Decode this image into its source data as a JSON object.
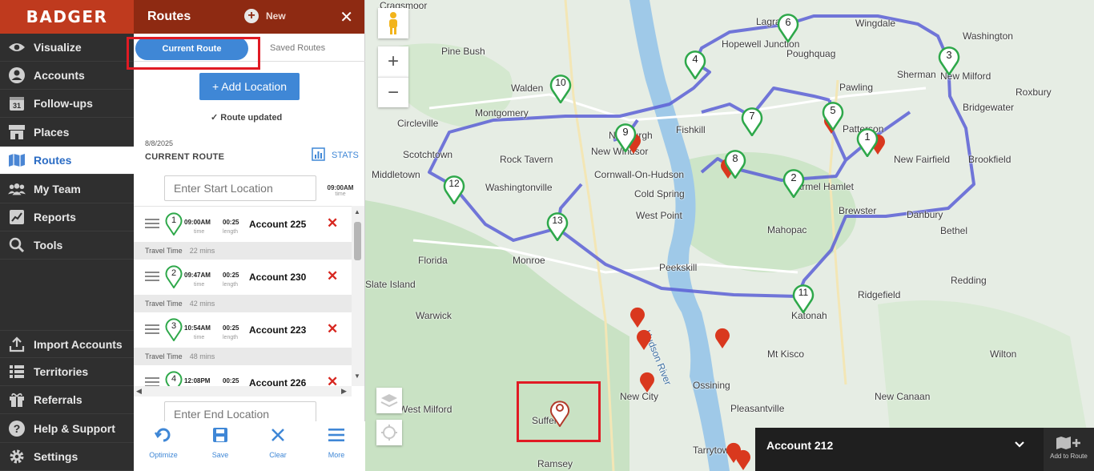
{
  "brand": "BADGER",
  "nav": {
    "items": [
      {
        "label": "Visualize"
      },
      {
        "label": "Accounts"
      },
      {
        "label": "Follow-ups"
      },
      {
        "label": "Places"
      },
      {
        "label": "Routes"
      },
      {
        "label": "My Team"
      },
      {
        "label": "Reports"
      },
      {
        "label": "Tools"
      }
    ],
    "bottom_items": [
      {
        "label": "Import Accounts"
      },
      {
        "label": "Territories"
      },
      {
        "label": "Referrals"
      },
      {
        "label": "Help & Support"
      },
      {
        "label": "Settings"
      }
    ],
    "active": "Routes"
  },
  "panel": {
    "title": "Routes",
    "new_label": "New",
    "close": "✕",
    "tabs": {
      "current": "Current Route",
      "saved": "Saved Routes"
    },
    "add_location": "+ Add Location",
    "route_updated": "Route updated",
    "route_date": "8/8/2025",
    "route_label": "CURRENT ROUTE",
    "stats": "STATS",
    "start_placeholder": "Enter Start Location",
    "start_time": "09:00AM",
    "time_label": "time",
    "length_label": "length",
    "travel_label": "Travel Time",
    "end_placeholder": "Enter End Location",
    "stops": [
      {
        "num": "1",
        "time": "09:00AM",
        "length": "00:25",
        "account": "Account 225",
        "travel": "22 mins"
      },
      {
        "num": "2",
        "time": "09:47AM",
        "length": "00:25",
        "account": "Account 230",
        "travel": "42 mins"
      },
      {
        "num": "3",
        "time": "10:54AM",
        "length": "00:25",
        "account": "Account 223",
        "travel": "48 mins"
      },
      {
        "num": "4",
        "time": "12:08PM",
        "length": "00:25",
        "account": "Account 226"
      }
    ],
    "footer": {
      "optimize": "Optimize",
      "save": "Save",
      "clear": "Clear",
      "more": "More"
    }
  },
  "map": {
    "places": [
      "Cragsmoor",
      "Lagrange",
      "Wingdale",
      "Washington",
      "Pine Bush",
      "Hopewell Junction",
      "Poughquag",
      "Sherman",
      "New Milford",
      "Walden",
      "Pawling",
      "Roxbury",
      "Fishkill",
      "Montgomery",
      "Bridgewater",
      "Circleville",
      "Patterson",
      "Newburgh",
      "New Windsor",
      "Rock Tavern",
      "New Fairfield",
      "Brookfield",
      "Scotchtown",
      "Cornwall-On-Hudson",
      "Middletown",
      "Washingtonville",
      "Cold Spring",
      "Carmel Hamlet",
      "West Point",
      "Brewster",
      "Danbury",
      "Mahopac",
      "Bethel",
      "Florida",
      "Monroe",
      "Peekskill",
      "Redding",
      "Ridgefield",
      "Slate Island",
      "Warwick",
      "Katonah",
      "Hudson River",
      "Mt Kisco",
      "Wilton",
      "New City",
      "Ossining",
      "West Milford",
      "Suffern",
      "Pleasantville",
      "New Canaan",
      "Tarrytown",
      "Ramsey"
    ],
    "selected_account": "Account 212",
    "add_to_route": "Add to Route"
  },
  "colors": {
    "brand": "#bf3a1e",
    "panel_header": "#8e2a12",
    "accent": "#3f87d6",
    "route_line": "#5b5fd6",
    "stop_pin": "#2ea84a",
    "account_pin": "#d9381e",
    "highlight": "#e01b24"
  }
}
